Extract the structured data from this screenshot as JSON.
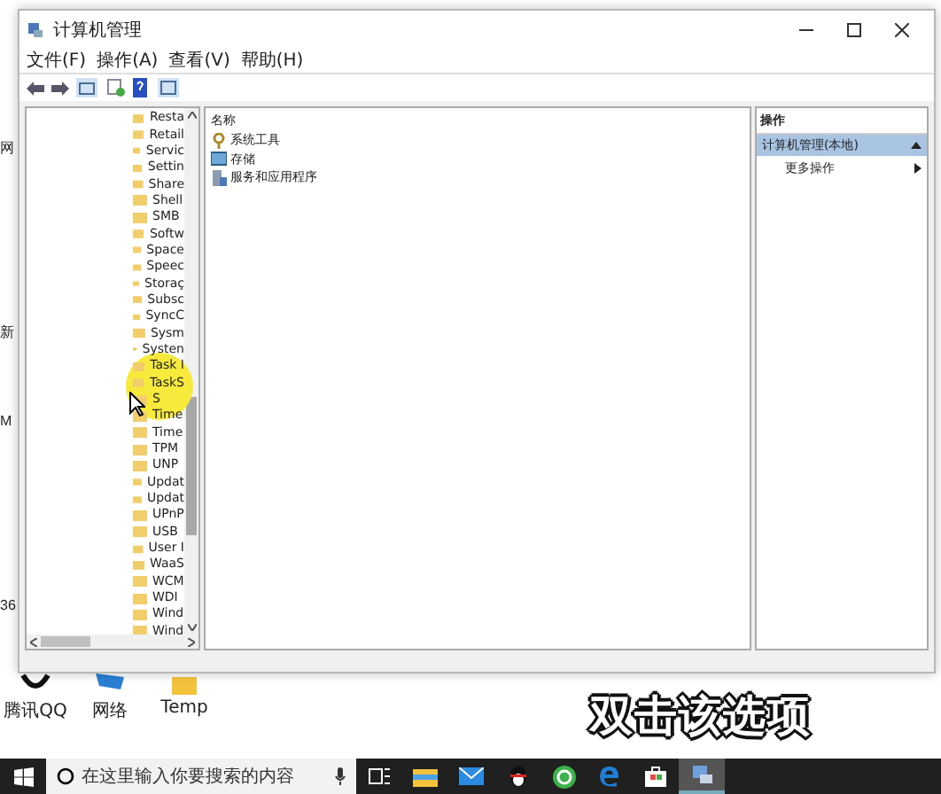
{
  "window": {
    "title": "计算机管理"
  },
  "menu": [
    "文件(F)",
    "操作(A)",
    "查看(V)",
    "帮助(H)"
  ],
  "tree": {
    "items": [
      "Resta",
      "Retail",
      "Servic",
      "Settin",
      "Share",
      "Shell",
      "SMB",
      "Softw",
      "Space",
      "Speec",
      "Storaç",
      "Subsc",
      "SyncC",
      "Sysm",
      "Systen",
      "Task I",
      "TaskS",
      "S",
      "Time",
      "Time",
      "TPM",
      "UNP",
      "Updat",
      "Updat",
      "UPnP",
      "USB",
      "User I",
      "WaaS",
      "WCM",
      "WDI",
      "Wind",
      "Wind"
    ]
  },
  "list": {
    "column": "名称",
    "items": [
      {
        "label": "系统工具",
        "kind": "tools"
      },
      {
        "label": "存储",
        "kind": "storage"
      },
      {
        "label": "服务和应用程序",
        "kind": "services"
      }
    ]
  },
  "actions": {
    "header": "操作",
    "group": {
      "label": "计算机管理(本地)",
      "selected": true,
      "expanded": true
    },
    "items": [
      "更多操作"
    ]
  },
  "edge_labels": [
    "网",
    "新",
    "M",
    "36"
  ],
  "desktop_icons": [
    {
      "label": "腾讯QQ",
      "kind": "qq"
    },
    {
      "label": "网络",
      "kind": "network"
    },
    {
      "label": "Temp",
      "kind": "folder"
    }
  ],
  "caption": "双击该选项",
  "taskbar": {
    "search": {
      "placeholder": "在这里输入你要搜索的内容"
    },
    "apps": [
      {
        "kind": "taskview",
        "selected": false
      },
      {
        "kind": "explorer",
        "selected": false
      },
      {
        "kind": "mail",
        "selected": false
      },
      {
        "kind": "qq",
        "selected": false
      },
      {
        "kind": "browser",
        "selected": false
      },
      {
        "kind": "edge",
        "selected": false
      },
      {
        "kind": "store",
        "selected": false
      },
      {
        "kind": "compmgmt",
        "selected": true
      }
    ]
  }
}
